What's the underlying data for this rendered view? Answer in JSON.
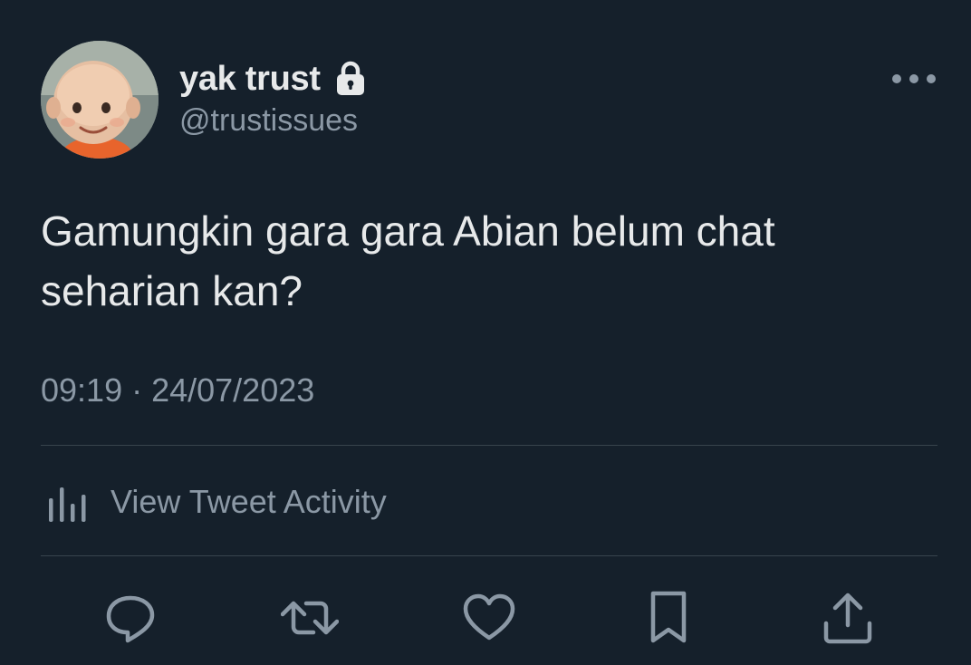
{
  "author": {
    "display_name": "yak trust",
    "handle": "@trustissues",
    "protected_icon": "lock-icon",
    "avatar_icon": "cartoon-boy-avatar"
  },
  "tweet": {
    "text": "Gamungkin gara gara Abian belum chat seharian kan?",
    "timestamp": "09:19 · 24/07/2023"
  },
  "activity": {
    "label": "View Tweet Activity",
    "icon": "bar-chart-icon"
  },
  "actions": [
    {
      "name": "reply",
      "icon": "reply-icon"
    },
    {
      "name": "retweet",
      "icon": "retweet-icon"
    },
    {
      "name": "like",
      "icon": "heart-icon"
    },
    {
      "name": "bookmark",
      "icon": "bookmark-icon"
    },
    {
      "name": "share",
      "icon": "share-icon"
    }
  ],
  "colors": {
    "background": "#15202b",
    "primary_text": "#e7e9ea",
    "secondary_text": "#8b98a5",
    "divider": "#38444d"
  }
}
